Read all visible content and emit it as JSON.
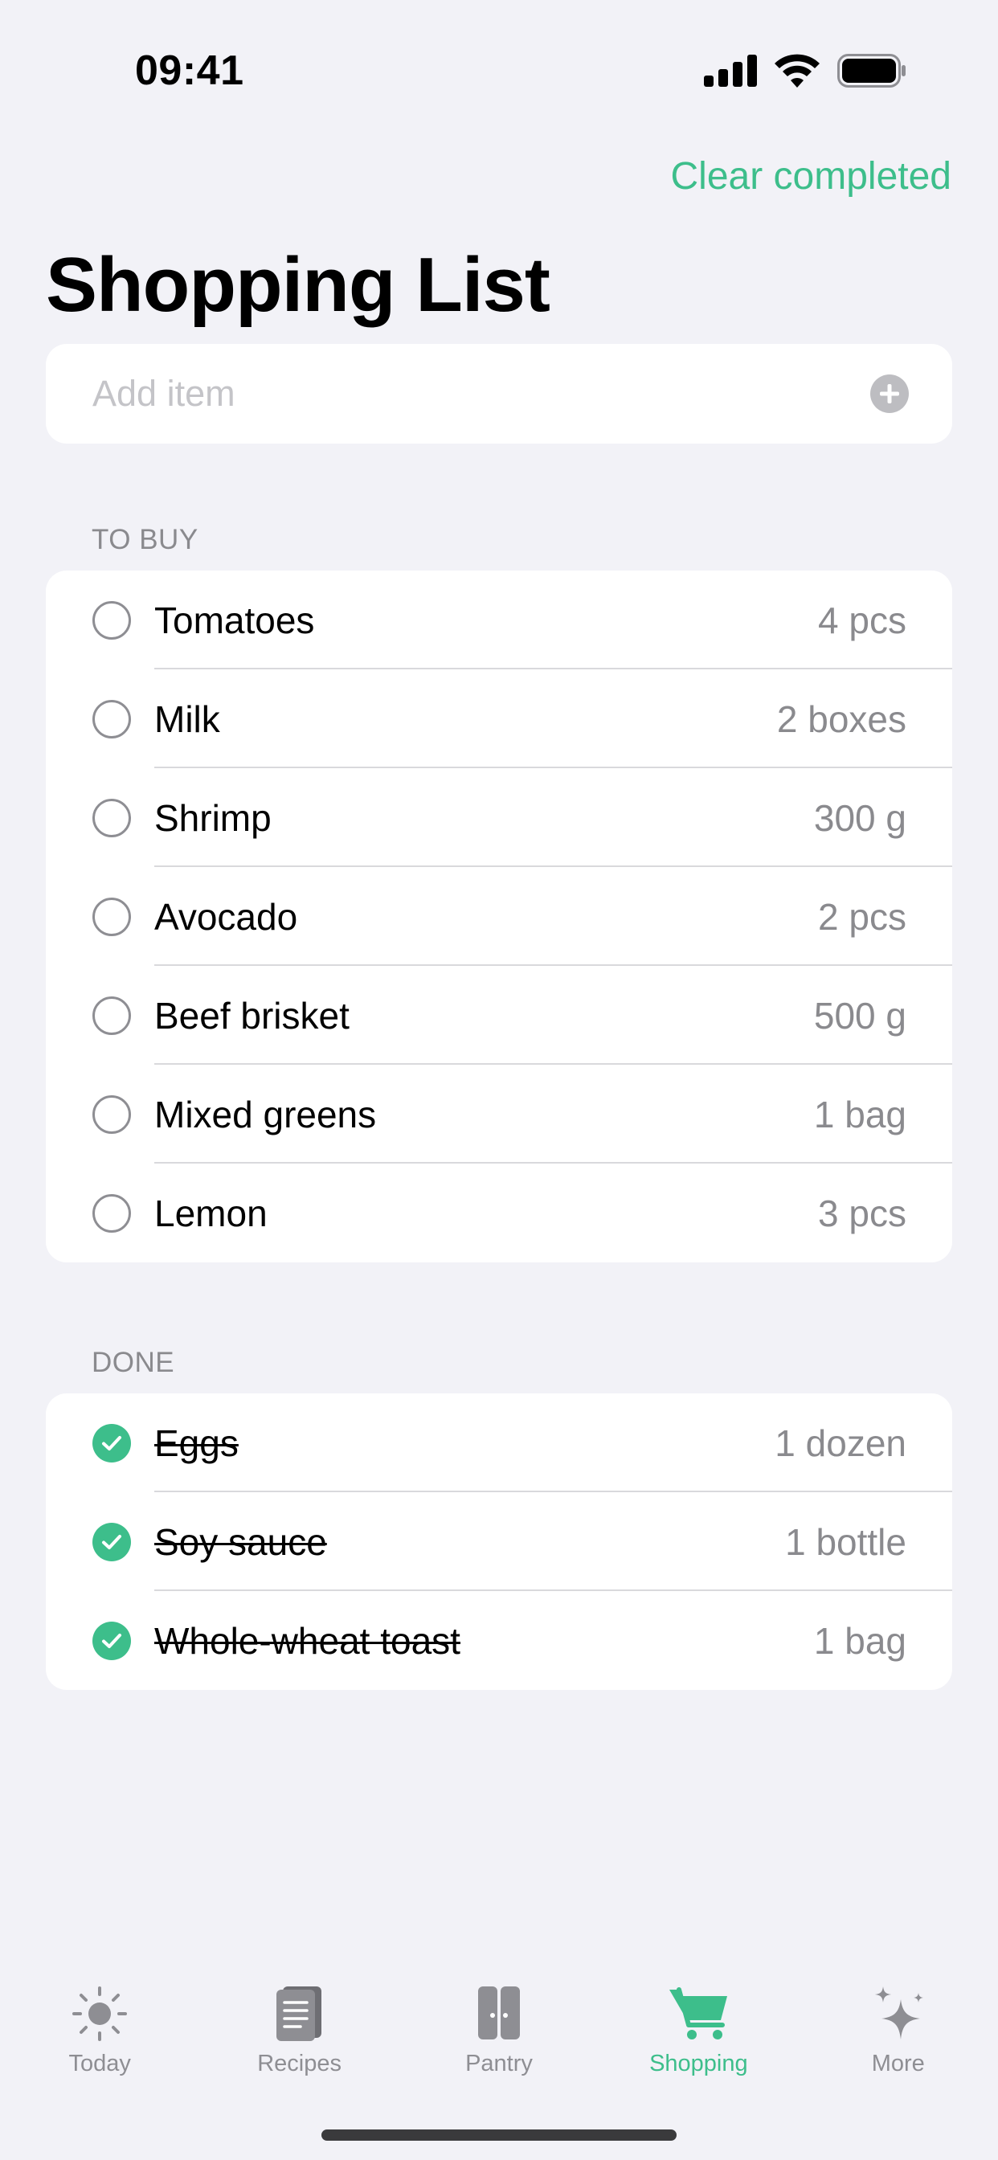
{
  "status_bar": {
    "time": "09:41"
  },
  "header": {
    "action_label": "Clear completed",
    "title": "Shopping List"
  },
  "add_item": {
    "placeholder": "Add item"
  },
  "sections": {
    "to_buy": {
      "title": "TO BUY",
      "items": [
        {
          "name": "Tomatoes",
          "qty": "4 pcs"
        },
        {
          "name": "Milk",
          "qty": "2 boxes"
        },
        {
          "name": "Shrimp",
          "qty": "300 g"
        },
        {
          "name": "Avocado",
          "qty": "2 pcs"
        },
        {
          "name": "Beef brisket",
          "qty": "500 g"
        },
        {
          "name": "Mixed greens",
          "qty": "1 bag"
        },
        {
          "name": "Lemon",
          "qty": "3 pcs"
        }
      ]
    },
    "done": {
      "title": "DONE",
      "items": [
        {
          "name": "Eggs",
          "qty": "1 dozen"
        },
        {
          "name": "Soy sauce",
          "qty": "1 bottle"
        },
        {
          "name": "Whole-wheat toast",
          "qty": "1 bag"
        }
      ]
    }
  },
  "tab_bar": {
    "tabs": [
      {
        "label": "Today",
        "icon": "sun-icon"
      },
      {
        "label": "Recipes",
        "icon": "recipe-book-icon"
      },
      {
        "label": "Pantry",
        "icon": "pantry-cabinet-icon"
      },
      {
        "label": "Shopping",
        "icon": "shopping-cart-icon",
        "active": true
      },
      {
        "label": "More",
        "icon": "sparkles-icon"
      }
    ]
  },
  "colors": {
    "accent": "#3DBE8B",
    "background": "#F2F2F7",
    "secondary_text": "#8A8A8E"
  }
}
